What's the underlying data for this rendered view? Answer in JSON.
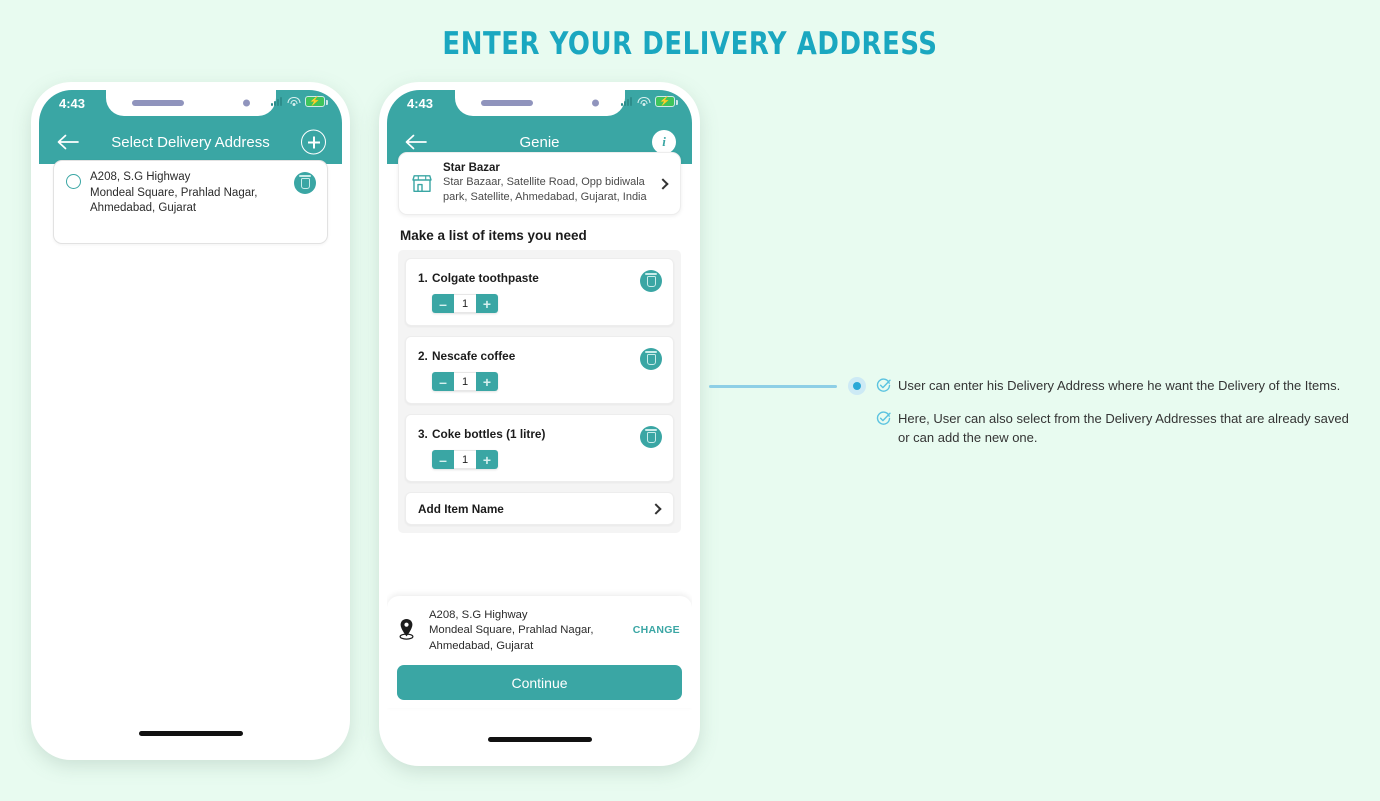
{
  "page": {
    "title": "ENTER YOUR DELIVERY ADDRESS",
    "background_color": "#e8fbf0",
    "title_color": "#1aa7c0",
    "accent_teal": "#3aa6a4",
    "annotation_blue": "#8ecfe6"
  },
  "phone1": {
    "status_bar": {
      "time": "4:43",
      "signal_icon": "signal-bars-icon",
      "wifi_icon": "wifi-icon",
      "battery_icon": "battery-charging-icon"
    },
    "navbar": {
      "back_icon": "back-arrow-icon",
      "title": "Select Delivery Address",
      "action_icon": "plus-circle-icon"
    },
    "address_card": {
      "radio_icon": "radio-unchecked-icon",
      "delete_icon": "trash-icon",
      "line1": "A208, S.G Highway",
      "line2": "Mondeal Square, Prahlad Nagar,",
      "line3": "Ahmedabad, Gujarat"
    },
    "home_indicator": "home-indicator"
  },
  "phone2": {
    "status_bar": {
      "time": "4:43",
      "signal_icon": "signal-bars-icon",
      "wifi_icon": "wifi-icon",
      "battery_icon": "battery-charging-icon"
    },
    "navbar": {
      "back_icon": "back-arrow-icon",
      "title": "Genie",
      "action_icon": "info-circle-icon"
    },
    "store_card": {
      "icon": "storefront-icon",
      "name": "Star Bazar",
      "address_line1": "Star Bazaar, Satellite Road, Opp bidiwala",
      "address_line2": "park, Satellite, Ahmedabad, Gujarat, India",
      "chevron_icon": "chevron-right-icon"
    },
    "section_title": "Make a list of items you need",
    "items": [
      {
        "number": "1.",
        "name": "Colgate toothpaste",
        "qty": "1",
        "minus": "–",
        "plus": "+",
        "delete_icon": "trash-icon"
      },
      {
        "number": "2.",
        "name": "Nescafe coffee",
        "qty": "1",
        "minus": "–",
        "plus": "+",
        "delete_icon": "trash-icon"
      },
      {
        "number": "3.",
        "name": "Coke bottles (1 litre)",
        "qty": "1",
        "minus": "–",
        "plus": "+",
        "delete_icon": "trash-icon"
      }
    ],
    "add_item": {
      "label": "Add Item Name",
      "chevron_icon": "chevron-right-icon"
    },
    "bottom_address": {
      "pin_icon": "location-pin-icon",
      "line1": "A208, S.G Highway",
      "line2": "Mondeal Square, Prahlad Nagar,",
      "line3": "Ahmedabad, Gujarat",
      "change_label": "CHANGE"
    },
    "continue_label": "Continue",
    "home_indicator": "home-indicator"
  },
  "annotation": {
    "connector_icon": "connector-line",
    "dot_icon": "connector-dot",
    "notes": [
      {
        "check_icon": "check-circle-icon",
        "text": "User can enter his Delivery Address where he want the Delivery of the Items."
      },
      {
        "check_icon": "check-circle-icon",
        "text": "Here, User can also select from the Delivery Addresses that are already saved or can add the new one."
      }
    ]
  }
}
